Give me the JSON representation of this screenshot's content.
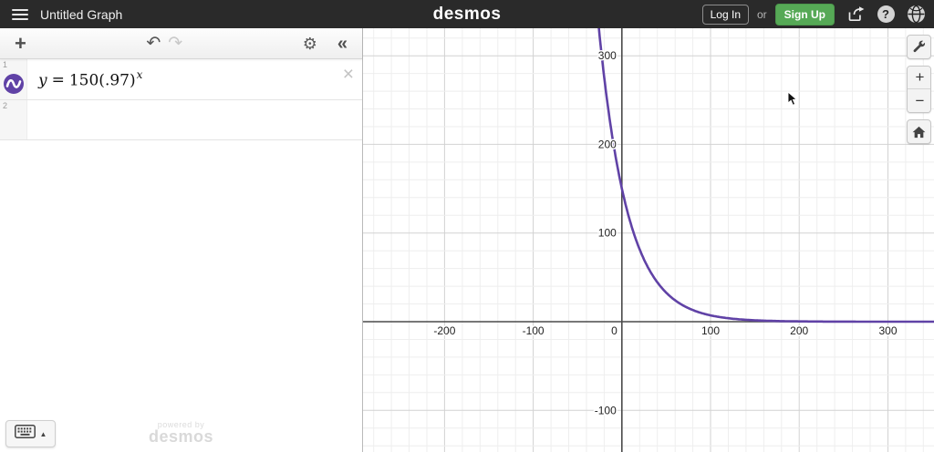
{
  "topbar": {
    "title": "Untitled Graph",
    "logo": "desmos",
    "login_label": "Log In",
    "or_label": "or",
    "signup_label": "Sign Up",
    "help_glyph": "?"
  },
  "panel": {
    "toolbar": {
      "add_glyph": "+",
      "undo_glyph": "↶",
      "redo_glyph": "↷",
      "settings_glyph": "⚙",
      "collapse_glyph": "«"
    },
    "rows": [
      {
        "index": "1",
        "lhs": "y",
        "eq": "=",
        "body": "150(.97)",
        "exponent": "x",
        "close_glyph": "×"
      },
      {
        "index": "2"
      }
    ],
    "keyboard_toggle": {
      "arrow_glyph": "▲"
    },
    "watermark": {
      "line1": "powered by",
      "line2": "desmos"
    }
  },
  "graph_controls": {
    "zoom_in_glyph": "+",
    "zoom_out_glyph": "−"
  },
  "chart_data": {
    "type": "line",
    "expression": "y = 150(.97)^x",
    "series": [
      {
        "name": "y=150(.97)^x",
        "fn": {
          "a": 150,
          "b": 0.97
        },
        "color": "#6042a6"
      }
    ],
    "x_axis": {
      "min": -292,
      "max": 352,
      "major_step": 100,
      "minor_per_major": 5,
      "tick_labels": [
        -200,
        -100,
        0,
        100,
        200,
        300
      ]
    },
    "y_axis": {
      "min": -147,
      "max": 331,
      "major_step": 100,
      "minor_per_major": 5,
      "tick_labels": [
        300,
        200,
        100,
        -100
      ]
    },
    "grid": true,
    "axis_color": "#4a4a4a",
    "major_grid_color": "#d2d2d2",
    "minor_grid_color": "#eeeeee",
    "label_color": "#222222"
  }
}
